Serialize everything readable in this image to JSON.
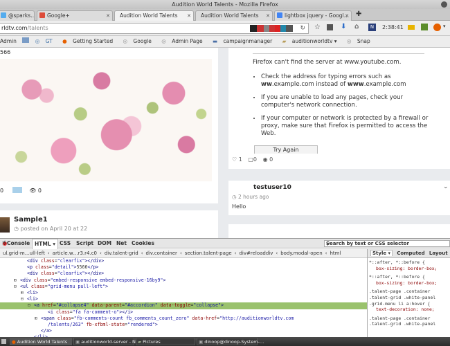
{
  "window": {
    "title": "Audition World Talents - Mozilla Firefox"
  },
  "tabs": [
    {
      "label": "@sparks…",
      "active": false,
      "fav": "#3b5998"
    },
    {
      "label": "Google+",
      "active": false,
      "fav": "#dd4b39"
    },
    {
      "label": "Audition World Talents",
      "active": true,
      "fav": "#888"
    },
    {
      "label": "Audition World Talents",
      "active": false,
      "fav": "#888"
    },
    {
      "label": "lightbox jquery - Googl…",
      "active": false,
      "fav": "#4285f4"
    }
  ],
  "toolbar": {
    "url_domain": "rldtv.com",
    "url_path": "/talents",
    "time": "2:38:41"
  },
  "bookmarks": {
    "items": [
      "Admin",
      "GT",
      "Getting Started",
      "Google",
      "Admin Page",
      "campaignmanager",
      "auditionworldtv ▾",
      "Snap"
    ]
  },
  "feed": {
    "left_top_count": "566",
    "left_counts": {
      "likes": "0",
      "views": "0"
    },
    "error": {
      "title": "Firefox can't find the server at www.youtube.com.",
      "items": [
        {
          "pre": "Check the address for typing errors such as ",
          "b1": "ww",
          "mid": ".example.com instead of ",
          "b2": "www",
          "post": ".example.com"
        },
        {
          "text": "If you are unable to load any pages, check your computer's network connection."
        },
        {
          "text": "If your computer or network is protected by a firewall or proxy, make sure that Firefox is permitted to access the Web."
        }
      ],
      "try_again": "Try Again"
    },
    "right_stats": {
      "likes": "1",
      "comments": "0",
      "views": "0"
    },
    "post": {
      "user": "testuser10",
      "time": "2 hours ago",
      "body": "Hello"
    },
    "sample": {
      "name": "Sample1",
      "posted": "posted on April 20 at 22"
    }
  },
  "devtools": {
    "tabs": [
      "Console",
      "HTML ▾",
      "CSS",
      "Script",
      "DOM",
      "Net",
      "Cookies"
    ],
    "search_placeholder": "Search by text or CSS selector",
    "breadcrumbs": [
      "ul.grid-m…ull-left",
      "article.w…r3.r4.c0",
      "div.talent-grid",
      "div.container",
      "section.talent-page",
      "div#reloaddiv",
      "body.modal-open",
      "html"
    ],
    "side_tabs": [
      "Style ▾",
      "Computed",
      "Layout"
    ],
    "code": [
      {
        "indent": 3,
        "exp": "",
        "html": "<span class='tag'>&lt;div</span> <span class='attr'>class</span>=<span class='val'>\"clearfix\"</span><span class='tag'>&gt;&lt;/div&gt;</span>"
      },
      {
        "indent": 3,
        "exp": "",
        "html": "<span class='tag'>&lt;p</span> <span class='attr'>class</span>=<span class='val'>\"detail\"</span><span class='tag'>&gt;</span>5566<span class='tag'>&lt;/p&gt;</span>"
      },
      {
        "indent": 3,
        "exp": "",
        "html": "<span class='tag'>&lt;div</span> <span class='attr'>class</span>=<span class='val'>\"clearfix\"</span><span class='tag'>&gt;&lt;/div&gt;</span>"
      },
      {
        "indent": 2,
        "exp": "⊞",
        "html": "<span class='tag'>&lt;div</span> <span class='attr'>class</span>=<span class='val'>\"embed-responsive embed-responsive-16by9\"</span><span class='tag'>&gt;</span>"
      },
      {
        "indent": 2,
        "exp": "⊟",
        "html": "<span class='tag'>&lt;ul</span> <span class='attr'>class</span>=<span class='val'>\"grid-menu pull-left\"</span><span class='tag'>&gt;</span>"
      },
      {
        "indent": 3,
        "exp": "⊞",
        "html": "<span class='tag'>&lt;li&gt;</span>"
      },
      {
        "indent": 3,
        "exp": "⊟",
        "html": "<span class='tag'>&lt;li&gt;</span>"
      },
      {
        "indent": 4,
        "exp": "⊟",
        "hl": true,
        "html": "<span class='tag'>&lt;a</span> <span class='attr'>href</span>=<span class='val'>\"#collapse4\"</span> <span class='attr'>data-parent</span>=<span class='val'>\"#accordion\"</span> <span class='attr'>data-toggle</span>=<span class='val'>\"collapse\"</span><span class='tag'>&gt;</span>"
      },
      {
        "indent": 6,
        "exp": "",
        "html": "<span class='tag'>&lt;i</span> <span class='attr'>class</span>=<span class='val'>\"fa fa-comment-o\"</span><span class='tag'>&gt;&lt;/i&gt;</span>"
      },
      {
        "indent": 5,
        "exp": "⊞",
        "html": "<span class='tag'>&lt;span</span> <span class='attr'>class</span>=<span class='val'>\"fb-comments-count fb_comments_count_zero\"</span> <span class='attr'>data-href</span>=<span class='val'>\"http://auditionworldtv.com</span>"
      },
      {
        "indent": 6,
        "exp": "",
        "html": "<span class='val'>/talents/263\"</span> <span class='attr'>fb-xfbml-state</span>=<span class='val'>\"rendered\"</span><span class='tag'>&gt;</span>"
      },
      {
        "indent": 5,
        "exp": "",
        "html": "<span class='tag'>&lt;/a&gt;</span>"
      },
      {
        "indent": 4,
        "exp": "",
        "html": "<span class='tag'>&lt;/li&gt;</span>"
      }
    ],
    "css": [
      {
        "sel": "*::after, *::before {",
        "src": "bootstr"
      },
      {
        "prop": "box-sizing: border-box;"
      },
      {
        "sel": "*::after, *::before {",
        "src": "bootstr"
      },
      {
        "prop": "box-sizing: border-box;"
      },
      {
        "sel": ".talent-page .container",
        "src": "st"
      },
      {
        "sel": ".talent-grid .white-panel"
      },
      {
        "sel": ".grid-menu li a:hover {"
      },
      {
        "prop": "text-decoration: none;"
      },
      {
        "sel": ".talent-page .container",
        "src": "st"
      },
      {
        "sel": ".talent-grid .white-panel"
      }
    ]
  },
  "taskbar": {
    "items": [
      "Audition World Talents",
      "auditionworld-server - N…",
      "Pictures",
      "dinoop@dinoop-System-…"
    ]
  }
}
